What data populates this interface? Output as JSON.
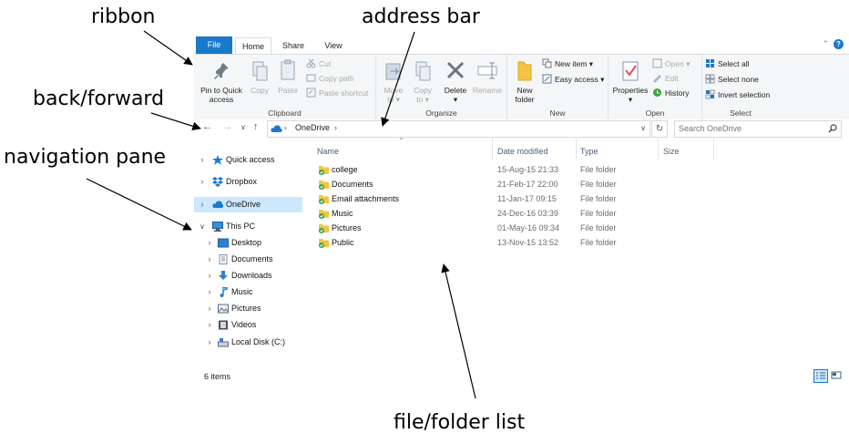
{
  "annotations": {
    "ribbon": "ribbon",
    "address_bar": "address bar",
    "back_forward": "back/forward",
    "navigation_pane": "navigation pane",
    "file_list": "file/folder list"
  },
  "tabs": {
    "file": "File",
    "home": "Home",
    "share": "Share",
    "view": "View"
  },
  "ribbon": {
    "clipboard": {
      "label": "Clipboard",
      "pin_line1": "Pin to Quick",
      "pin_line2": "access",
      "copy": "Copy",
      "paste": "Paste",
      "cut": "Cut",
      "copy_path": "Copy path",
      "paste_shortcut": "Paste shortcut"
    },
    "organize": {
      "label": "Organize",
      "move_line1": "Move",
      "move_line2": "to ▾",
      "copy_line1": "Copy",
      "copy_line2": "to ▾",
      "delete_line1": "Delete",
      "delete_line2": "▾",
      "rename": "Rename"
    },
    "new": {
      "label": "New",
      "new_folder_line1": "New",
      "new_folder_line2": "folder",
      "new_item": "New item ▾",
      "easy_access": "Easy access ▾"
    },
    "open": {
      "label": "Open",
      "properties_line1": "Properties",
      "properties_line2": "▾",
      "open": "Open ▾",
      "edit": "Edit",
      "history": "History"
    },
    "select": {
      "label": "Select",
      "select_all": "Select all",
      "select_none": "Select none",
      "invert_selection": "Invert selection"
    }
  },
  "addressbar": {
    "path": "OneDrive",
    "search_placeholder": "Search OneDrive"
  },
  "navpane": {
    "items": [
      {
        "label": "Quick access",
        "icon": "star-icon"
      },
      {
        "label": "Dropbox",
        "icon": "dropbox-icon"
      },
      {
        "label": "OneDrive",
        "icon": "cloud-icon",
        "selected": true
      },
      {
        "label": "This PC",
        "icon": "computer-icon",
        "expanded": true
      },
      {
        "label": "Desktop",
        "icon": "desktop-icon"
      },
      {
        "label": "Documents",
        "icon": "document-icon"
      },
      {
        "label": "Downloads",
        "icon": "download-icon"
      },
      {
        "label": "Music",
        "icon": "music-icon"
      },
      {
        "label": "Pictures",
        "icon": "pictures-icon"
      },
      {
        "label": "Videos",
        "icon": "video-icon"
      },
      {
        "label": "Local Disk (C:)",
        "icon": "disk-icon"
      }
    ]
  },
  "filelist": {
    "columns": {
      "name": "Name",
      "date": "Date modified",
      "type": "Type",
      "size": "Size"
    },
    "rows": [
      {
        "name": "college",
        "date": "15-Aug-15 21:33",
        "type": "File folder"
      },
      {
        "name": "Documents",
        "date": "21-Feb-17 22:00",
        "type": "File folder"
      },
      {
        "name": "Email attachments",
        "date": "11-Jan-17 09:15",
        "type": "File folder"
      },
      {
        "name": "Music",
        "date": "24-Dec-16 03:39",
        "type": "File folder"
      },
      {
        "name": "Pictures",
        "date": "01-May-16 09:34",
        "type": "File folder"
      },
      {
        "name": "Public",
        "date": "13-Nov-15 13:52",
        "type": "File folder"
      }
    ]
  },
  "status": {
    "count": "6 items"
  },
  "colors": {
    "accent": "#1979ca",
    "selection": "#cce8ff",
    "folder": "#f5c542",
    "sync_check": "#3fa33f"
  }
}
